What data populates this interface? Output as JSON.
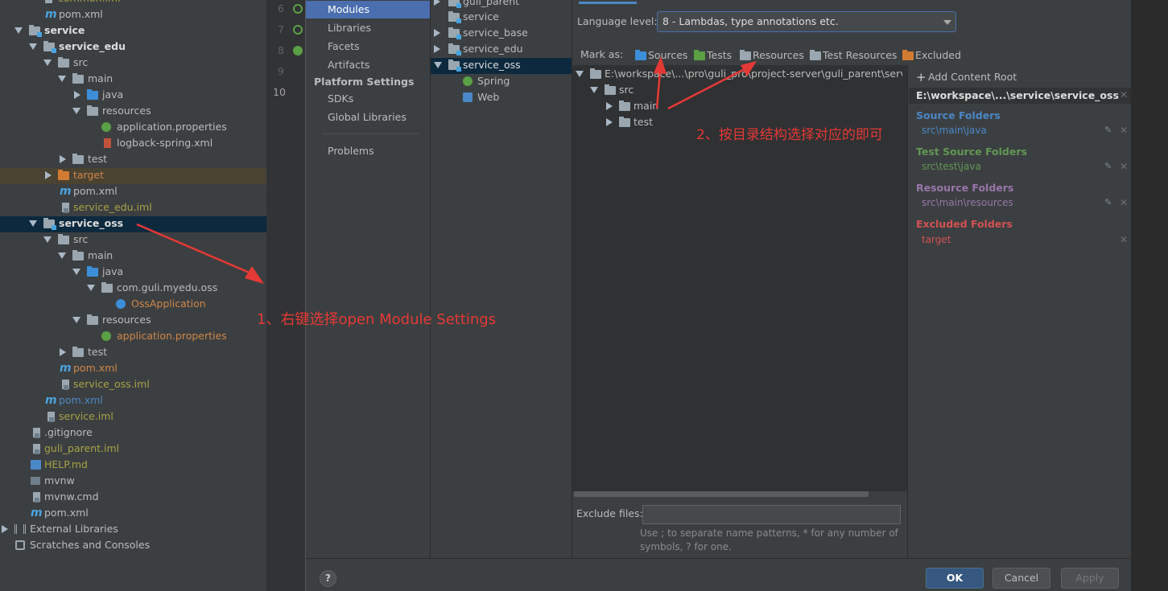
{
  "project_tree": {
    "top_cut": "common.iml",
    "items": [
      {
        "label": "pom.xml"
      },
      {
        "label": "service"
      },
      {
        "label": "service_edu"
      },
      {
        "label": "src"
      },
      {
        "label": "main"
      },
      {
        "label": "java"
      },
      {
        "label": "resources"
      },
      {
        "label": "application.properties"
      },
      {
        "label": "logback-spring.xml"
      },
      {
        "label": "test"
      },
      {
        "label": "target"
      },
      {
        "label": "pom.xml"
      },
      {
        "label": "service_edu.iml"
      },
      {
        "label": "service_oss"
      },
      {
        "label": "src"
      },
      {
        "label": "main"
      },
      {
        "label": "java"
      },
      {
        "label": "com.guli.myedu.oss"
      },
      {
        "label": "OssApplication"
      },
      {
        "label": "resources"
      },
      {
        "label": "application.properties"
      },
      {
        "label": "test"
      },
      {
        "label": "pom.xml"
      },
      {
        "label": "service_oss.iml"
      },
      {
        "label": "pom.xml"
      },
      {
        "label": "service.iml"
      },
      {
        "label": ".gitignore"
      },
      {
        "label": "guli_parent.iml"
      },
      {
        "label": "HELP.md"
      },
      {
        "label": "mvnw"
      },
      {
        "label": "mvnw.cmd"
      },
      {
        "label": "pom.xml"
      },
      {
        "label": "External Libraries"
      },
      {
        "label": "Scratches and Consoles"
      }
    ]
  },
  "gutter": {
    "lines": [
      "6",
      "7",
      "8",
      "9",
      "10"
    ]
  },
  "annotations": {
    "note1": "1、右键选择open Module Settings",
    "note2": "2、按目录结构选择对应的即可"
  },
  "nav": {
    "items": [
      "Modules",
      "Libraries",
      "Facets",
      "Artifacts"
    ],
    "platform_header": "Platform Settings",
    "platform_items": [
      "SDKs",
      "Global Libraries"
    ],
    "problems": "Problems"
  },
  "modules": {
    "items": [
      "guli_parent",
      "service",
      "service_base",
      "service_edu",
      "service_oss",
      "Spring",
      "Web"
    ]
  },
  "content": {
    "language_level_label": "Language level:",
    "language_level_value": "8 - Lambdas, type annotations etc.",
    "mark_as": "Mark as:",
    "mark_buttons": [
      "Sources",
      "Tests",
      "Resources",
      "Test Resources",
      "Excluded"
    ],
    "root_path": "E:\\workspace\\...\\pro\\guli_pro\\project-server\\guli_parent\\service\\ser",
    "tree": [
      "src",
      "main",
      "test"
    ],
    "exclude_label": "Exclude files:",
    "exclude_value": "",
    "exclude_hint": "Use ; to separate name patterns, * for any number of symbols, ? for one."
  },
  "roots": {
    "add_content_root": "Add Content Root",
    "root_title": "E:\\workspace\\...\\service\\service_oss",
    "source_header": "Source Folders",
    "source_path": "src\\main\\java",
    "test_header": "Test Source Folders",
    "test_path": "src\\test\\java",
    "resource_header": "Resource Folders",
    "resource_path": "src\\main\\resources",
    "excluded_header": "Excluded Folders",
    "excluded_path": "target"
  },
  "footer": {
    "help": "?",
    "ok": "OK",
    "cancel": "Cancel",
    "apply": "Apply"
  },
  "colors": {
    "accent": "#4b6eaf",
    "arrow": "#e53935",
    "source": "#4a88c7",
    "test": "#629755",
    "resource": "#9876aa",
    "excluded": "#d25252"
  }
}
